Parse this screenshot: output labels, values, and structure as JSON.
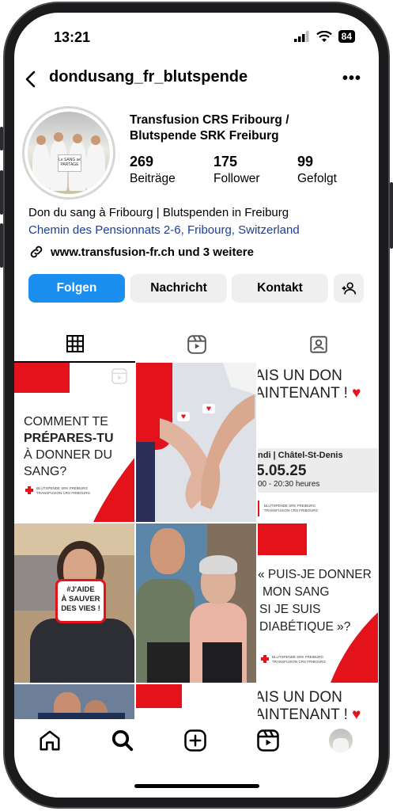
{
  "status": {
    "time": "13:21",
    "battery": "84"
  },
  "header": {
    "username": "dondusang_fr_blutspende"
  },
  "profile": {
    "name_line1": "Transfusion CRS Fribourg /",
    "name_line2": "Blutspende SRK Freiburg",
    "avatar_sign": "Le SANG se PARTAGE",
    "stats": [
      {
        "value": "269",
        "label": "Beiträge"
      },
      {
        "value": "175",
        "label": "Follower"
      },
      {
        "value": "99",
        "label": "Gefolgt"
      }
    ],
    "bio": "Don du sang à Fribourg | Blutspenden in Freiburg",
    "address": "Chemin des Pensionnats 2-6, Fribourg, Switzerland",
    "link": "www.transfusion-fr.ch und 3 weitere"
  },
  "buttons": {
    "follow": "Folgen",
    "message": "Nachricht",
    "contact": "Kontakt"
  },
  "posts": {
    "p1": {
      "line1": "COMMENT TE",
      "line2": "PRÉPARES-TU",
      "line3": "À DONNER DU",
      "line4": "SANG?",
      "logo1": "BLUTSPENDE SRK FREIBURG",
      "logo2": "TRANSFUSION CRS FRIBOURG"
    },
    "p3": {
      "line1": "AIS UN DON",
      "line2": "AINTENANT !",
      "place": "ndi | Châtel-St-Denis",
      "date": "5.05.25",
      "hours": "00 - 20:30 heures",
      "logo1": "BLUTSPENDE SRK FREIBURG",
      "logo2": "TRANSFUSION CRS FRIBOURG"
    },
    "p4": {
      "sign1": "#J'AIDE",
      "sign2": "À SAUVER",
      "sign3": "DES VIES !"
    },
    "p6": {
      "line1": "« PUIS-JE DONNER",
      "line2": "MON SANG",
      "line3": "SI JE SUIS",
      "line4": "DIABÉTIQUE »?",
      "logo1": "BLUTSPENDE SRK FREIBURG",
      "logo2": "TRANSFUSION CRS FRIBOURG"
    },
    "p9": {
      "line1": "AIS UN DON",
      "line2": "AINTENANT !"
    }
  },
  "colors": {
    "accent": "#1a8ff0",
    "brand_red": "#e3121b",
    "link_blue": "#1c3f94"
  }
}
